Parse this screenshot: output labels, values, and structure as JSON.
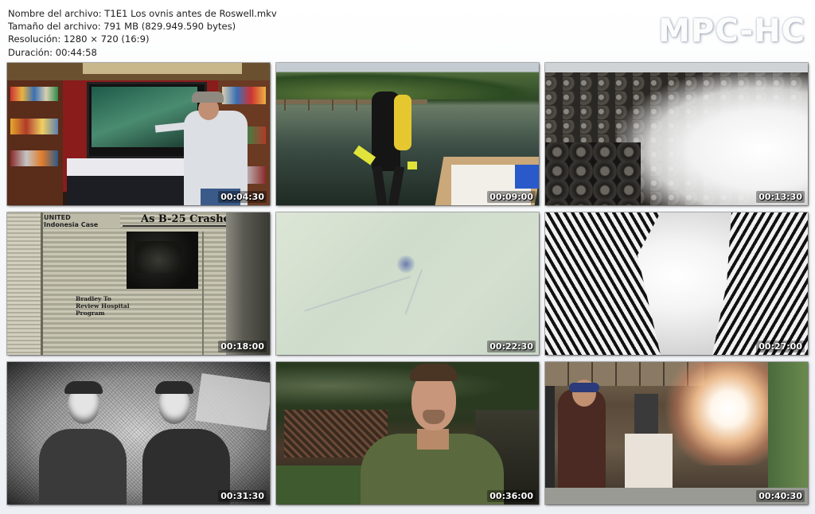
{
  "file_info": {
    "filename": "Nombre del archivo: T1E1 Los ovnis antes de Roswell.mkv",
    "size": "Tamaño del archivo: 791 MB (829.949.590 bytes)",
    "resolution": "Resolución: 1280 × 720 (16:9)",
    "duration": "Duración: 00:44:58"
  },
  "logo": "MPC-HC",
  "thumbnails": [
    {
      "timestamp": "00:04:30",
      "scene": "man-at-tv-bookshelf"
    },
    {
      "timestamp": "00:09:00",
      "scene": "scuba-diver-lake"
    },
    {
      "timestamp": "00:13:30",
      "scene": "stones-smoke"
    },
    {
      "timestamp": "00:18:00",
      "scene": "newspaper"
    },
    {
      "timestamp": "00:22:30",
      "scene": "pale-blur"
    },
    {
      "timestamp": "00:27:00",
      "scene": "bw-abstract"
    },
    {
      "timestamp": "00:31:30",
      "scene": "bw-photo-two-men"
    },
    {
      "timestamp": "00:36:00",
      "scene": "man-interview"
    },
    {
      "timestamp": "00:40:30",
      "scene": "lab-explosion"
    }
  ],
  "newspaper": {
    "headline": "As B-25 Crashes",
    "subhead": "Bradley To Review Hospital Program"
  }
}
